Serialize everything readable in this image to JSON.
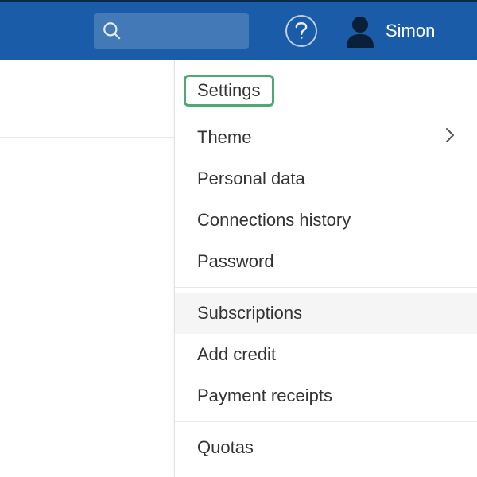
{
  "topbar": {
    "search_placeholder": "",
    "username": "Simon"
  },
  "menu": {
    "groups": [
      {
        "items": [
          {
            "label": "Settings",
            "highlighted": true,
            "has_submenu": false
          },
          {
            "label": "Theme",
            "highlighted": false,
            "has_submenu": true
          },
          {
            "label": "Personal data",
            "highlighted": false,
            "has_submenu": false
          },
          {
            "label": "Connections history",
            "highlighted": false,
            "has_submenu": false
          },
          {
            "label": "Password",
            "highlighted": false,
            "has_submenu": false
          }
        ]
      },
      {
        "items": [
          {
            "label": "Subscriptions",
            "highlighted": false,
            "has_submenu": false,
            "hovered": true
          },
          {
            "label": "Add credit",
            "highlighted": false,
            "has_submenu": false
          },
          {
            "label": "Payment receipts",
            "highlighted": false,
            "has_submenu": false
          }
        ]
      },
      {
        "items": [
          {
            "label": "Quotas",
            "highlighted": false,
            "has_submenu": false
          }
        ]
      }
    ]
  }
}
